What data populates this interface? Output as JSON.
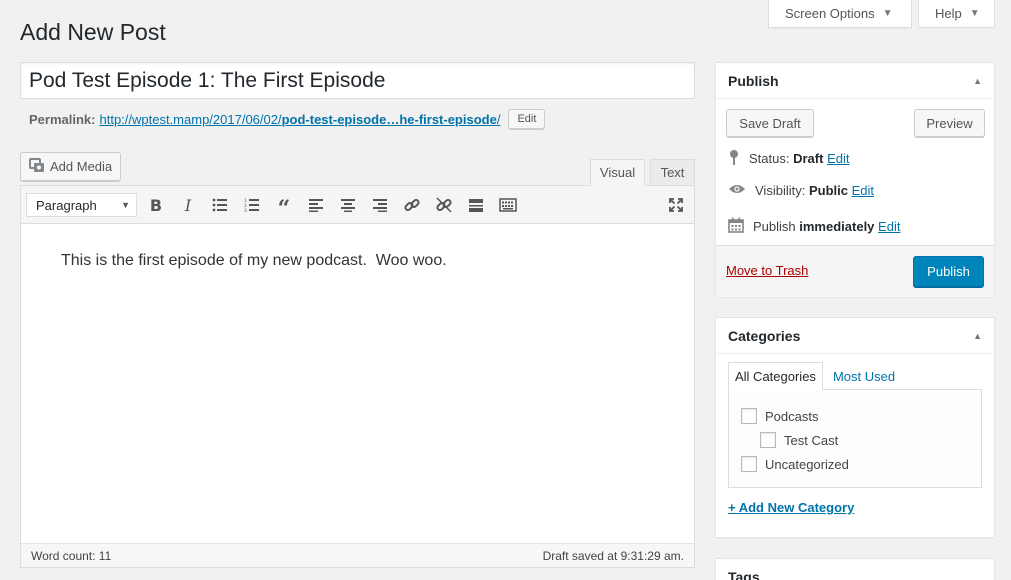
{
  "screen_meta": {
    "screen_options": "Screen Options",
    "help": "Help"
  },
  "page": {
    "title": "Add New Post"
  },
  "post": {
    "title": "Pod Test Episode 1: The First Episode",
    "permalink_label": "Permalink:",
    "permalink_base": "http://wptest.mamp/2017/06/02/",
    "permalink_slug": "pod-test-episode…he-first-episode",
    "permalink_trailing": "/",
    "permalink_edit": "Edit"
  },
  "editor": {
    "add_media": "Add Media",
    "tab_visual": "Visual",
    "tab_text": "Text",
    "format": "Paragraph",
    "toolbar_icons": [
      "bold-icon",
      "italic-icon",
      "bulleted-list-icon",
      "numbered-list-icon",
      "blockquote-icon",
      "align-left-icon",
      "align-center-icon",
      "align-right-icon",
      "insert-link-icon",
      "remove-link-icon",
      "read-more-icon",
      "toolbar-toggle-icon",
      "fullscreen-icon"
    ],
    "content": "This is the first episode of my new podcast.  Woo woo.",
    "word_count": "Word count: 11",
    "draft_saved": "Draft saved at 9:31:29 am."
  },
  "publish_box": {
    "heading": "Publish",
    "save_draft": "Save Draft",
    "preview": "Preview",
    "status_label": "Status:",
    "status_value": "Draft",
    "visibility_label": "Visibility:",
    "visibility_value": "Public",
    "publish_label": "Publish",
    "publish_value": "immediately",
    "edit": "Edit",
    "trash": "Move to Trash",
    "publish_button": "Publish"
  },
  "categories_box": {
    "heading": "Categories",
    "tab_all": "All Categories",
    "tab_most_used": "Most Used",
    "items": [
      {
        "label": "Podcasts",
        "checked": false
      },
      {
        "label": "Test Cast",
        "checked": false
      },
      {
        "label": "Uncategorized",
        "checked": false
      }
    ],
    "add_new": "+ Add New Category"
  },
  "tags_box": {
    "heading": "Tags"
  },
  "colors": {
    "primary": "#0085ba",
    "link": "#0073aa",
    "trash": "#a00",
    "background": "#f1f1f1"
  }
}
